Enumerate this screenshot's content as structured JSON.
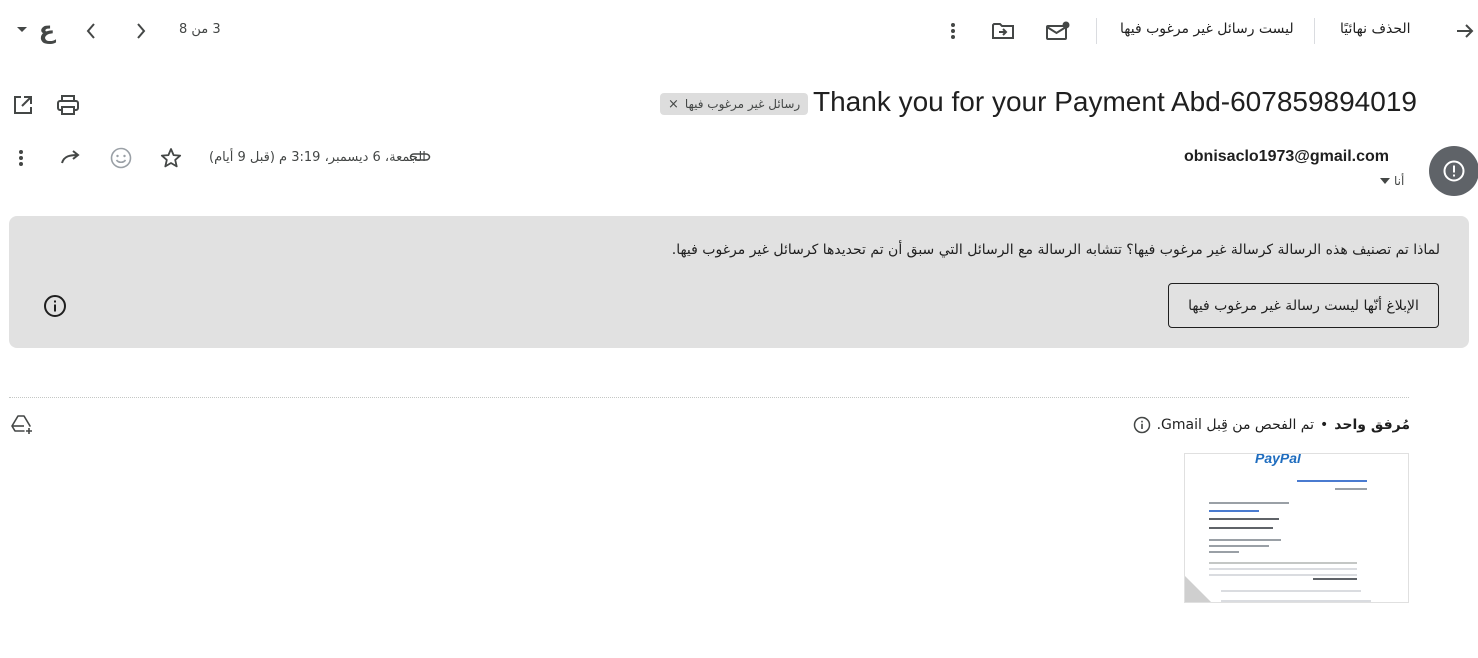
{
  "toolbar": {
    "delete_forever": "الحذف نهائيًا",
    "not_spam": "ليست رسائل غير مرغوب فيها",
    "pagination": "3 من 8",
    "input_tool_glyph": "ع"
  },
  "message": {
    "subject": "Thank you for your Payment Abd-607859894019",
    "label_chip": "رسائل غير مرغوب فيها",
    "sender_email": "obnisaclo1973@gmail.com",
    "recipient": "أنا",
    "date": "الجمعة، 6 ديسمبر، 3:19 م (قبل 9 أيام)"
  },
  "spam_banner": {
    "text": "لماذا تم تصنيف هذه الرسالة كرسالة غير مرغوب فيها؟ تتشابه الرسالة مع الرسائل التي سبق أن تم تحديدها كرسائل غير مرغوب فيها.",
    "report_button": "الإبلاغ أنّها ليست رسالة غير مرغوب فيها"
  },
  "attachments": {
    "count_label": "مُرفق واحد",
    "separator": "•",
    "scanned_text": "تم الفحص من قِبل Gmail.",
    "thumbnail_brand": "PayPal"
  },
  "colors": {
    "banner_bg": "#e1e1e1",
    "avatar_bg": "#5f6368",
    "chip_bg": "#dddddd",
    "paypal_blue": "#1f6dbf"
  }
}
